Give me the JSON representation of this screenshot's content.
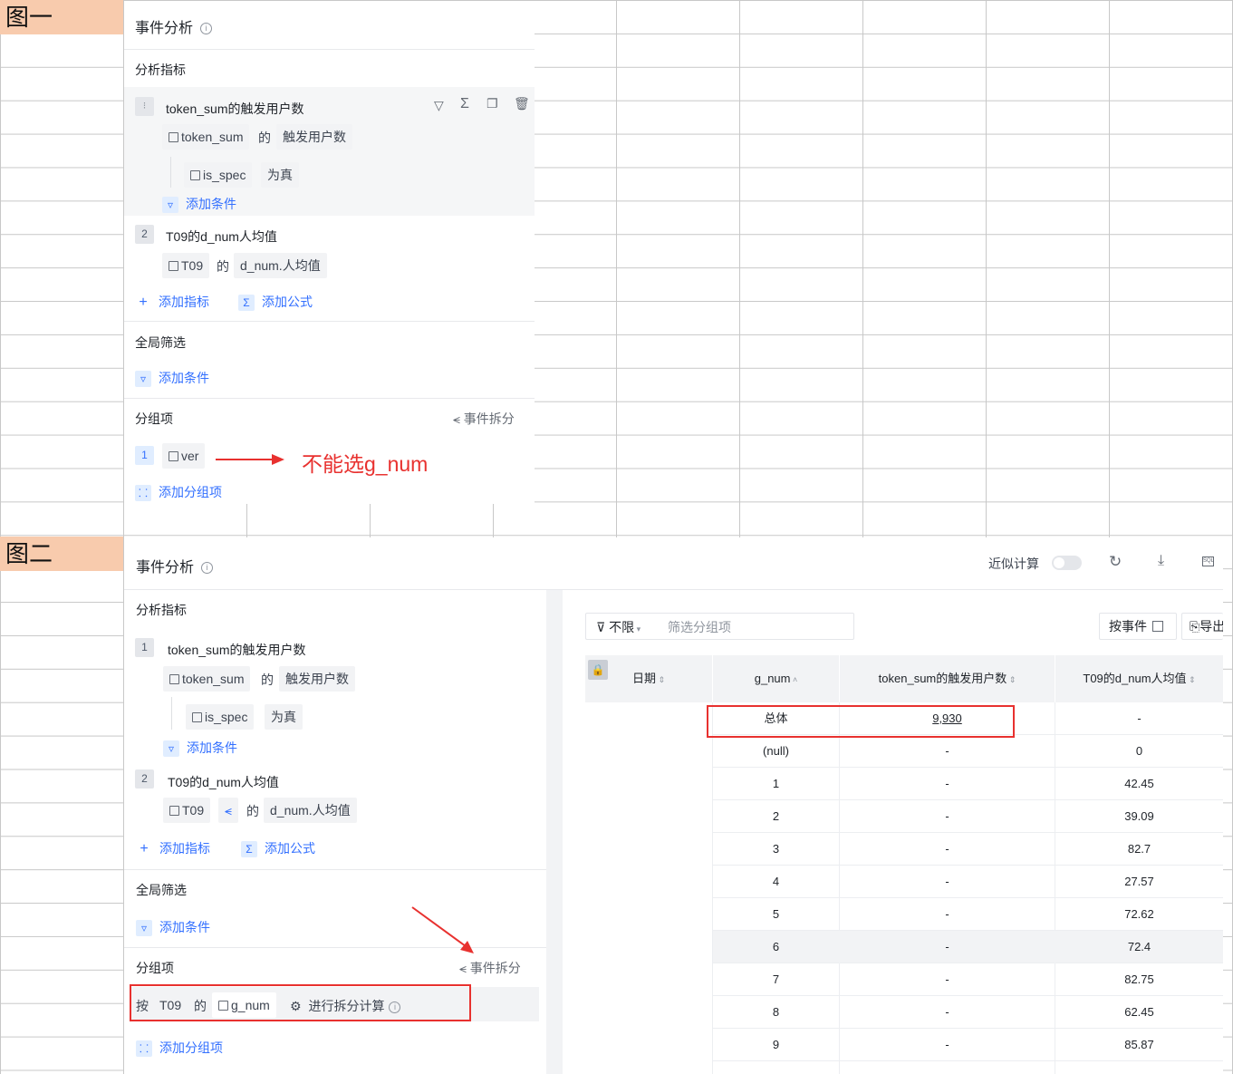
{
  "fig1": {
    "label": "图一",
    "title": "事件分析",
    "info": "i",
    "metrics_label": "分析指标",
    "m1": {
      "num": "1",
      "title": "token_sum的触发用户数",
      "event": "token_sum",
      "of": "的",
      "measure": "触发用户数",
      "filter_field": "is_spec",
      "filter_op": "为真",
      "add_cond": "添加条件"
    },
    "m2": {
      "num": "2",
      "title": "T09的d_num人均值",
      "event": "T09",
      "of": "的",
      "measure": "d_num.人均值"
    },
    "add_metric": "添加指标",
    "add_formula": "添加公式",
    "global_filter": "全局筛选",
    "global_add_cond": "添加条件",
    "group_label": "分组项",
    "event_split": "事件拆分",
    "g1": {
      "num": "1",
      "field": "ver"
    },
    "annotation": "不能选g_num",
    "add_group": "添加分组项"
  },
  "fig2": {
    "label": "图二",
    "title": "事件分析",
    "info": "i",
    "approx": "近似计算",
    "metrics_label": "分析指标",
    "m1": {
      "num": "1",
      "title": "token_sum的触发用户数",
      "event": "token_sum",
      "of": "的",
      "measure": "触发用户数",
      "filter_field": "is_spec",
      "filter_op": "为真",
      "add_cond": "添加条件"
    },
    "m2": {
      "num": "2",
      "title": "T09的d_num人均值",
      "event": "T09",
      "of": "的",
      "measure": "d_num.人均值"
    },
    "add_metric": "添加指标",
    "add_formula": "添加公式",
    "global_filter": "全局筛选",
    "global_add_cond": "添加条件",
    "group_label": "分组项",
    "event_split": "事件拆分",
    "group_row": {
      "by": "按",
      "event": "T09",
      "of": "的",
      "field": "g_num",
      "split_calc": "进行拆分计算"
    },
    "add_group": "添加分组项",
    "filter_scope": "不限",
    "filter_placeholder": "筛选分组项",
    "by_event": "按事件",
    "export": "导出",
    "table": {
      "headers": [
        "日期",
        "g_num",
        "token_sum的触发用户数",
        "T09的d_num人均值"
      ],
      "rows": [
        [
          "总体",
          "9,930",
          "-"
        ],
        [
          "(null)",
          "-",
          "0"
        ],
        [
          "1",
          "-",
          "42.45"
        ],
        [
          "2",
          "-",
          "39.09"
        ],
        [
          "3",
          "-",
          "82.7"
        ],
        [
          "4",
          "-",
          "27.57"
        ],
        [
          "5",
          "-",
          "72.62"
        ],
        [
          "6",
          "-",
          "72.4"
        ],
        [
          "7",
          "-",
          "82.75"
        ],
        [
          "8",
          "-",
          "62.45"
        ],
        [
          "9",
          "-",
          "85.87"
        ]
      ]
    }
  },
  "colors": {
    "accent": "#3370ff",
    "annotation": "#e8312f",
    "label_bg": "#f8cbad"
  }
}
